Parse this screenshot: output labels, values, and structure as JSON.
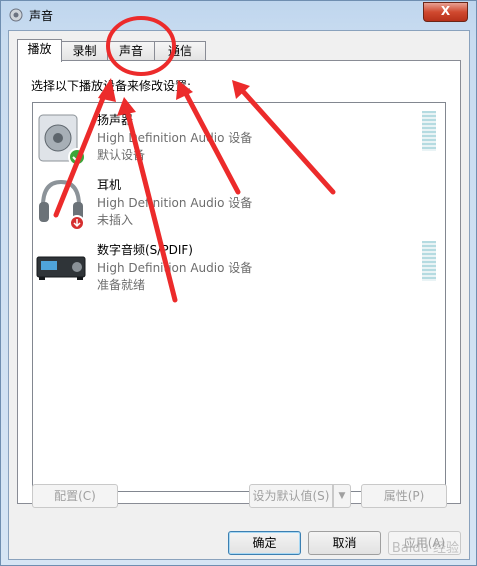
{
  "window": {
    "title": "声音",
    "close_label": "X"
  },
  "tabs": [
    {
      "label": "播放",
      "active": true
    },
    {
      "label": "录制",
      "active": false
    },
    {
      "label": "声音",
      "active": false
    },
    {
      "label": "通信",
      "active": false
    }
  ],
  "instruction": "选择以下播放设备来修改设置:",
  "devices": [
    {
      "name": "扬声器",
      "description": "High Definition Audio 设备",
      "status": "默认设备",
      "icon": "speaker-icon"
    },
    {
      "name": "耳机",
      "description": "High Definition Audio 设备",
      "status": "未插入",
      "icon": "headphones-icon"
    },
    {
      "name": "数字音频(S/PDIF)",
      "description": "High Definition Audio 设备",
      "status": "准备就绪",
      "icon": "digital-audio-icon"
    }
  ],
  "buttons": {
    "configure": "配置(C)",
    "set_default": "设为默认值(S)",
    "properties": "属性(P)",
    "ok": "确定",
    "cancel": "取消",
    "apply": "应用(A)"
  },
  "watermark": "Baidu 经验",
  "colors": {
    "annotation": "#ec2b2b",
    "accent": "#3c7fb1"
  }
}
